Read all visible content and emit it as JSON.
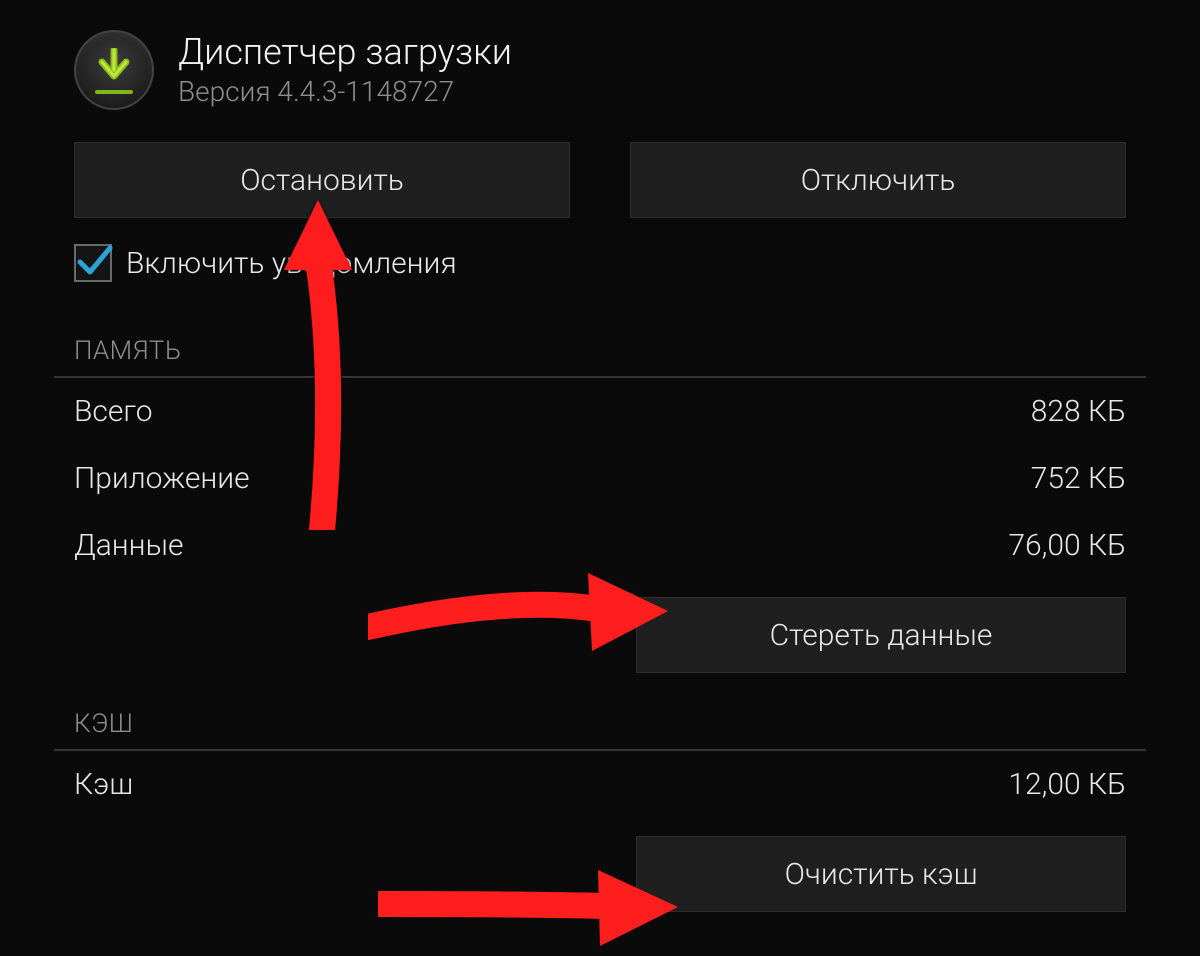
{
  "header": {
    "app_name": "Диспетчер загрузки",
    "version_line": "Версия 4.4.3-1148727"
  },
  "actions": {
    "stop_label": "Остановить",
    "disable_label": "Отключить"
  },
  "checkbox": {
    "notifications_label": "Включить уведомления",
    "notifications_checked": true
  },
  "memory": {
    "section_title": "ПАМЯТЬ",
    "rows": {
      "total": {
        "label": "Всего",
        "value": "828 КБ"
      },
      "app": {
        "label": "Приложение",
        "value": "752 КБ"
      },
      "data": {
        "label": "Данные",
        "value": "76,00 КБ"
      }
    },
    "clear_data_label": "Стереть данные"
  },
  "cache": {
    "section_title": "КЭШ",
    "rows": {
      "cache": {
        "label": "Кэш",
        "value": "12,00 КБ"
      }
    },
    "clear_cache_label": "Очистить кэш"
  },
  "annotations": {
    "arrow_tags": [
      "stop-button",
      "clear-data-button",
      "clear-cache-button"
    ]
  }
}
